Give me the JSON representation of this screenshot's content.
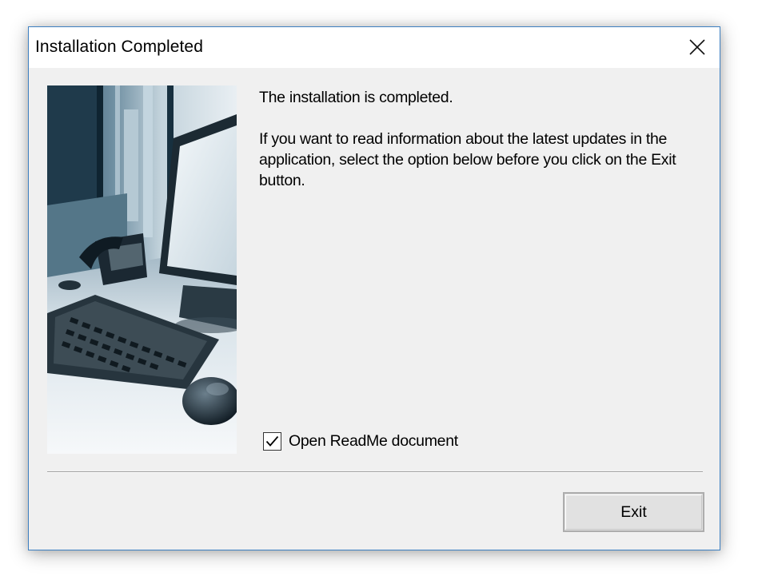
{
  "window": {
    "title": "Installation Completed",
    "close_icon": "close-icon"
  },
  "content": {
    "heading": "The installation is completed.",
    "message": "If you want to read information about the latest updates in the application, select the option below before you click on the Exit button."
  },
  "readme_option": {
    "label": "Open ReadMe document",
    "checked": true
  },
  "footer": {
    "exit_label": "Exit"
  },
  "colors": {
    "window_border": "#3c7fc1",
    "dialog_bg": "#f0f0f0",
    "titlebar_bg": "#ffffff",
    "button_bg": "#e1e1e1",
    "button_border": "#adadad"
  },
  "side_image": {
    "subject": "office desk with keyboard, mouse, telephone and monitor"
  }
}
